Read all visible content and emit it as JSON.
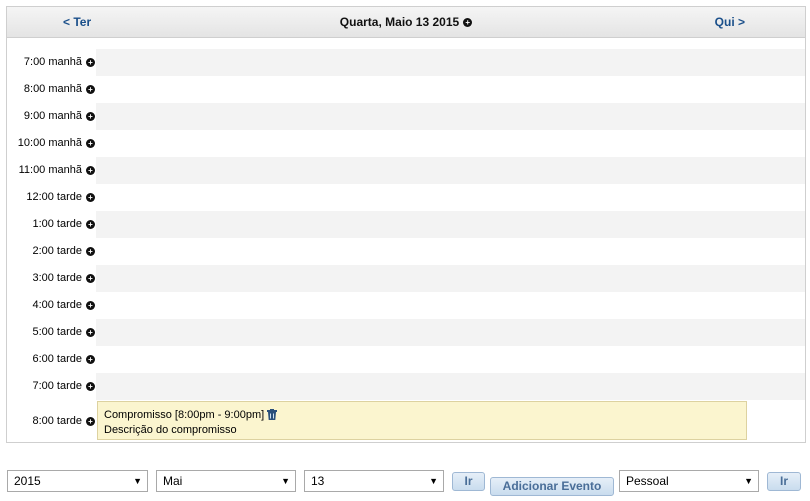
{
  "header": {
    "prev_label": "< Ter",
    "title": "Quarta, Maio 13 2015",
    "next_label": "Qui >"
  },
  "time_slots": [
    "7:00 manhã",
    "8:00 manhã",
    "9:00 manhã",
    "10:00 manhã",
    "11:00 manhã",
    "12:00 tarde",
    "1:00 tarde",
    "2:00 tarde",
    "3:00 tarde",
    "4:00 tarde",
    "5:00 tarde",
    "6:00 tarde",
    "7:00 tarde",
    "8:00 tarde"
  ],
  "event": {
    "title": "Compromisso [8:00pm - 9:00pm]",
    "description": "Descrição do compromisso"
  },
  "controls": {
    "year": "2015",
    "month": "Mai",
    "day": "13",
    "go_label": "Ir",
    "add_event_label": "Adicionar Evento",
    "calendar_type": "Pessoal",
    "go_label_2": "Ir"
  },
  "icons": {
    "add": "plus-circle-icon",
    "delete": "trash-icon",
    "dropdown": "chevron-down-icon"
  }
}
